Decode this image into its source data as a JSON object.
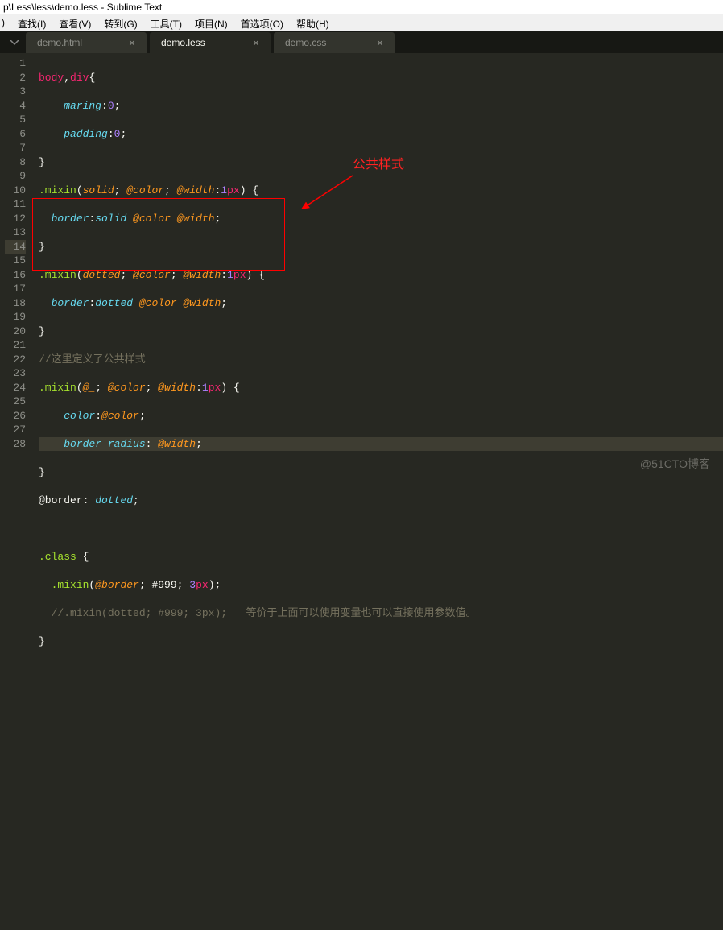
{
  "window": {
    "title": "p\\Less\\less\\demo.less - Sublime Text"
  },
  "menu": {
    "items": [
      "查找(I)",
      "查看(V)",
      "转到(G)",
      "工具(T)",
      "项目(N)",
      "首选项(O)",
      "帮助(H)"
    ],
    "leading": ")"
  },
  "tabs": [
    {
      "label": "demo.html",
      "active": false
    },
    {
      "label": "demo.less",
      "active": true
    },
    {
      "label": "demo.css",
      "active": false
    }
  ],
  "gutter": {
    "start": 1,
    "end": 28,
    "current": 14
  },
  "annotation": {
    "label": "公共样式"
  },
  "watermark": "@51CTO博客",
  "code": {
    "l1": {
      "a": "body",
      "b": ",",
      "c": "div",
      "d": "{"
    },
    "l2": {
      "a": "maring",
      "b": ":",
      "c": "0",
      "d": ";"
    },
    "l3": {
      "a": "padding",
      "b": ":",
      "c": "0",
      "d": ";"
    },
    "l4": {
      "a": "}"
    },
    "l5": {
      "a": ".mixin",
      "b": "(",
      "c": "solid",
      "d": "; ",
      "e": "@color",
      "f": "; ",
      "g": "@width",
      "h": ":",
      "i": "1",
      "j": "px",
      "k": ")",
      "l": " {"
    },
    "l6": {
      "a": "border",
      "b": ":",
      "c": "solid",
      "d": " ",
      "e": "@color",
      "f": " ",
      "g": "@width",
      "h": ";"
    },
    "l7": {
      "a": "}"
    },
    "l8": {
      "a": ".mixin",
      "b": "(",
      "c": "dotted",
      "d": "; ",
      "e": "@color",
      "f": "; ",
      "g": "@width",
      "h": ":",
      "i": "1",
      "j": "px",
      "k": ")",
      "l": " {"
    },
    "l9": {
      "a": "border",
      "b": ":",
      "c": "dotted",
      "d": " ",
      "e": "@color",
      "f": " ",
      "g": "@width",
      "h": ";"
    },
    "l10": {
      "a": "}"
    },
    "l11": {
      "a": "//这里定义了公共样式"
    },
    "l12": {
      "a": ".mixin",
      "b": "(",
      "c": "@_",
      "d": "; ",
      "e": "@color",
      "f": "; ",
      "g": "@width",
      "h": ":",
      "i": "1",
      "j": "px",
      "k": ")",
      "l": " {"
    },
    "l13": {
      "a": "color",
      "b": ":",
      "c": "@color",
      "d": ";"
    },
    "l14": {
      "a": "border-radius",
      "b": ": ",
      "c": "@width",
      "d": ";"
    },
    "l15": {
      "a": "}"
    },
    "l16": {
      "a": "@border",
      "b": ": ",
      "c": "dotted",
      "d": ";"
    },
    "l18": {
      "a": ".class",
      "b": " {"
    },
    "l19": {
      "a": ".mixin",
      "b": "(",
      "c": "@border",
      "d": "; ",
      "e": "#999",
      "f": "; ",
      "g": "3",
      "h": "px",
      "i": ")",
      "j": ";"
    },
    "l20": {
      "a": "//.mixin(dotted; #999; 3px);   等价于上面可以使用变量也可以直接使用参数值。"
    },
    "l21": {
      "a": "}"
    }
  }
}
